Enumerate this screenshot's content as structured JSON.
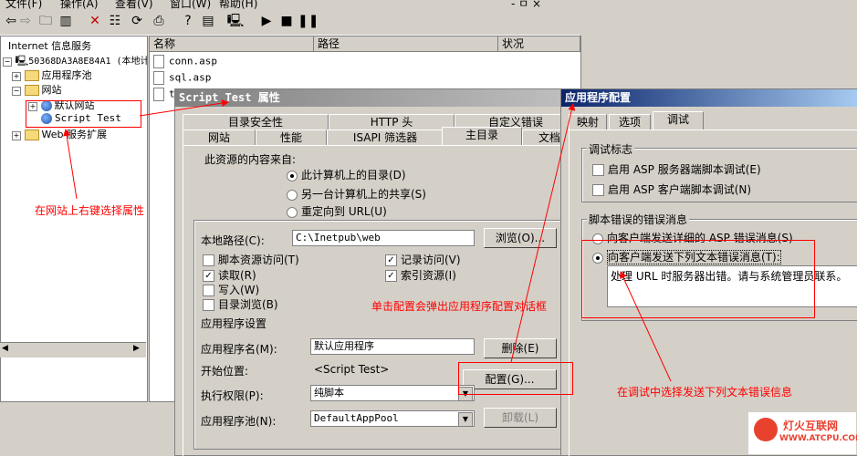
{
  "menubar": {
    "items": [
      "文件(F)",
      "操作(A)",
      "查看(V)",
      "窗口(W)",
      "帮助(H)"
    ],
    "right": "- ㅁ ×"
  },
  "tree": {
    "root": "Internet 信息服务",
    "server": "50368DA3A8E84A1 (本地计",
    "app_pools": "应用程序池",
    "sites": "网站",
    "default_site": "默认网站",
    "script_test": "Script Test",
    "web_ext": "Web 服务扩展"
  },
  "list": {
    "columns": [
      "名称",
      "路径",
      "状况"
    ],
    "files": [
      "conn.asp",
      "sql.asp",
      "t"
    ]
  },
  "props": {
    "title": "Script Test 属性",
    "tabs_row1": [
      "目录安全性",
      "HTTP 头",
      "自定义错误"
    ],
    "tabs_row2": [
      "网站",
      "性能",
      "ISAPI 筛选器",
      "主目录",
      "文档"
    ],
    "source_label": "此资源的内容来自:",
    "radio1": "此计算机上的目录(D)",
    "radio2": "另一台计算机上的共享(S)",
    "radio3": "重定向到 URL(U)",
    "local_path_label": "本地路径(C):",
    "local_path": "C:\\Inetpub\\web",
    "browse": "浏览(O)...",
    "chk_script_source": "脚本资源访问(T)",
    "chk_read": "读取(R)",
    "chk_write": "写入(W)",
    "chk_dir_browse": "目录浏览(B)",
    "chk_log": "记录访问(V)",
    "chk_index": "索引资源(I)",
    "app_settings": "应用程序设置",
    "app_name_label": "应用程序名(M):",
    "app_name": "默认应用程序",
    "remove": "删除(E)",
    "start_label": "开始位置:",
    "start_value": "<Script Test>",
    "config": "配置(G)...",
    "exec_label": "执行权限(P):",
    "exec_value": "纯脚本",
    "pool_label": "应用程序池(N):",
    "pool_value": "DefaultAppPool",
    "unload": "卸载(L)"
  },
  "appcfg": {
    "title": "应用程序配置",
    "tabs": [
      "映射",
      "选项",
      "调试"
    ],
    "debug_flags": "调试标志",
    "chk_server": "启用 ASP 服务器端脚本调试(E)",
    "chk_client": "启用 ASP 客户端脚本调试(N)",
    "errors_group": "脚本错误的错误消息",
    "radio_detail": "向客户端发送详细的 ASP 错误消息(S)",
    "radio_text": "向客户端发送下列文本错误消息(T):",
    "message": "处理 URL 时服务器出错。请与系统管理员联系。"
  },
  "annotations": {
    "right_click": "在网站上右键选择属性",
    "click_config": "单击配置会弹出应用程序配置对话框",
    "select_text": "在调试中选择发送下列文本错误信息"
  },
  "logo": {
    "name": "灯火互联网",
    "url": "WWW.ATCPU.COM"
  },
  "colors": {
    "title_active": "#0a246a",
    "title_inactive": "#808080",
    "annotation": "#ff0000"
  }
}
